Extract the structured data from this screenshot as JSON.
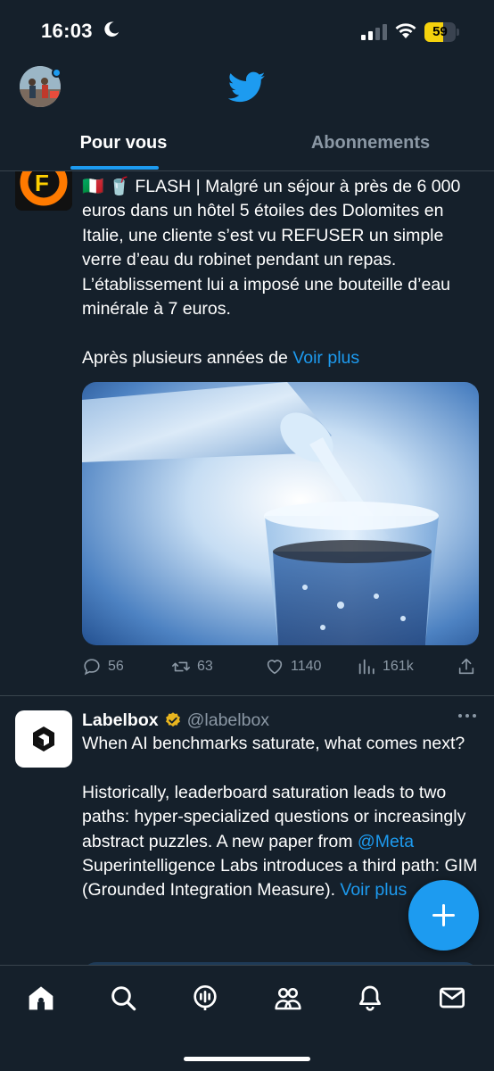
{
  "status_bar": {
    "time": "16:03",
    "battery_level": "59",
    "battery_fraction": 0.59,
    "icons": [
      "moon-icon",
      "signal-icon",
      "wifi-icon",
      "battery-icon"
    ]
  },
  "header": {
    "logo": "twitter-bird-icon",
    "tabs": [
      {
        "label": "Pour vous",
        "active": true
      },
      {
        "label": "Abonnements",
        "active": false
      }
    ]
  },
  "tweets": [
    {
      "avatar": "cf-logo",
      "text": "🇮🇹 🥤 FLASH | Malgré un séjour à près de 6 000 euros dans un hôtel 5 étoiles des Dolomites en Italie, une cliente s’est vu REFUSER un simple verre d’eau du robinet pendant un repas. L’établissement lui a imposé une bouteille d’eau minérale à 7 euros.\n\nAprès plusieurs années de",
      "more_link": "Voir plus",
      "media": "water-bottle-pouring-into-glass",
      "stats": {
        "replies": "56",
        "retweets": "63",
        "likes": "1140",
        "views": "161k"
      }
    },
    {
      "name": "Labelbox",
      "handle": "@labelbox",
      "verified": true,
      "text_1": "When AI benchmarks saturate, what comes next?\n\nHistorically, leaderboard saturation leads to two paths: hyper-specialized questions or increasingly abstract puzzles. A new paper from ",
      "mention": "@Meta",
      "text_2": " Superintelligence Labs introduces a third path: GIM (Grounded Integration Measure). ",
      "more_link": "Voir plus"
    }
  ],
  "fab": {
    "icon": "compose-plus-icon"
  },
  "bottom_nav": [
    "home-icon",
    "search-icon",
    "spaces-icon",
    "communities-icon",
    "notifications-icon",
    "messages-icon"
  ],
  "colors": {
    "background": "#15202b",
    "accent": "#1d9bf0",
    "muted": "#8b98a5",
    "divider": "#38444d"
  }
}
